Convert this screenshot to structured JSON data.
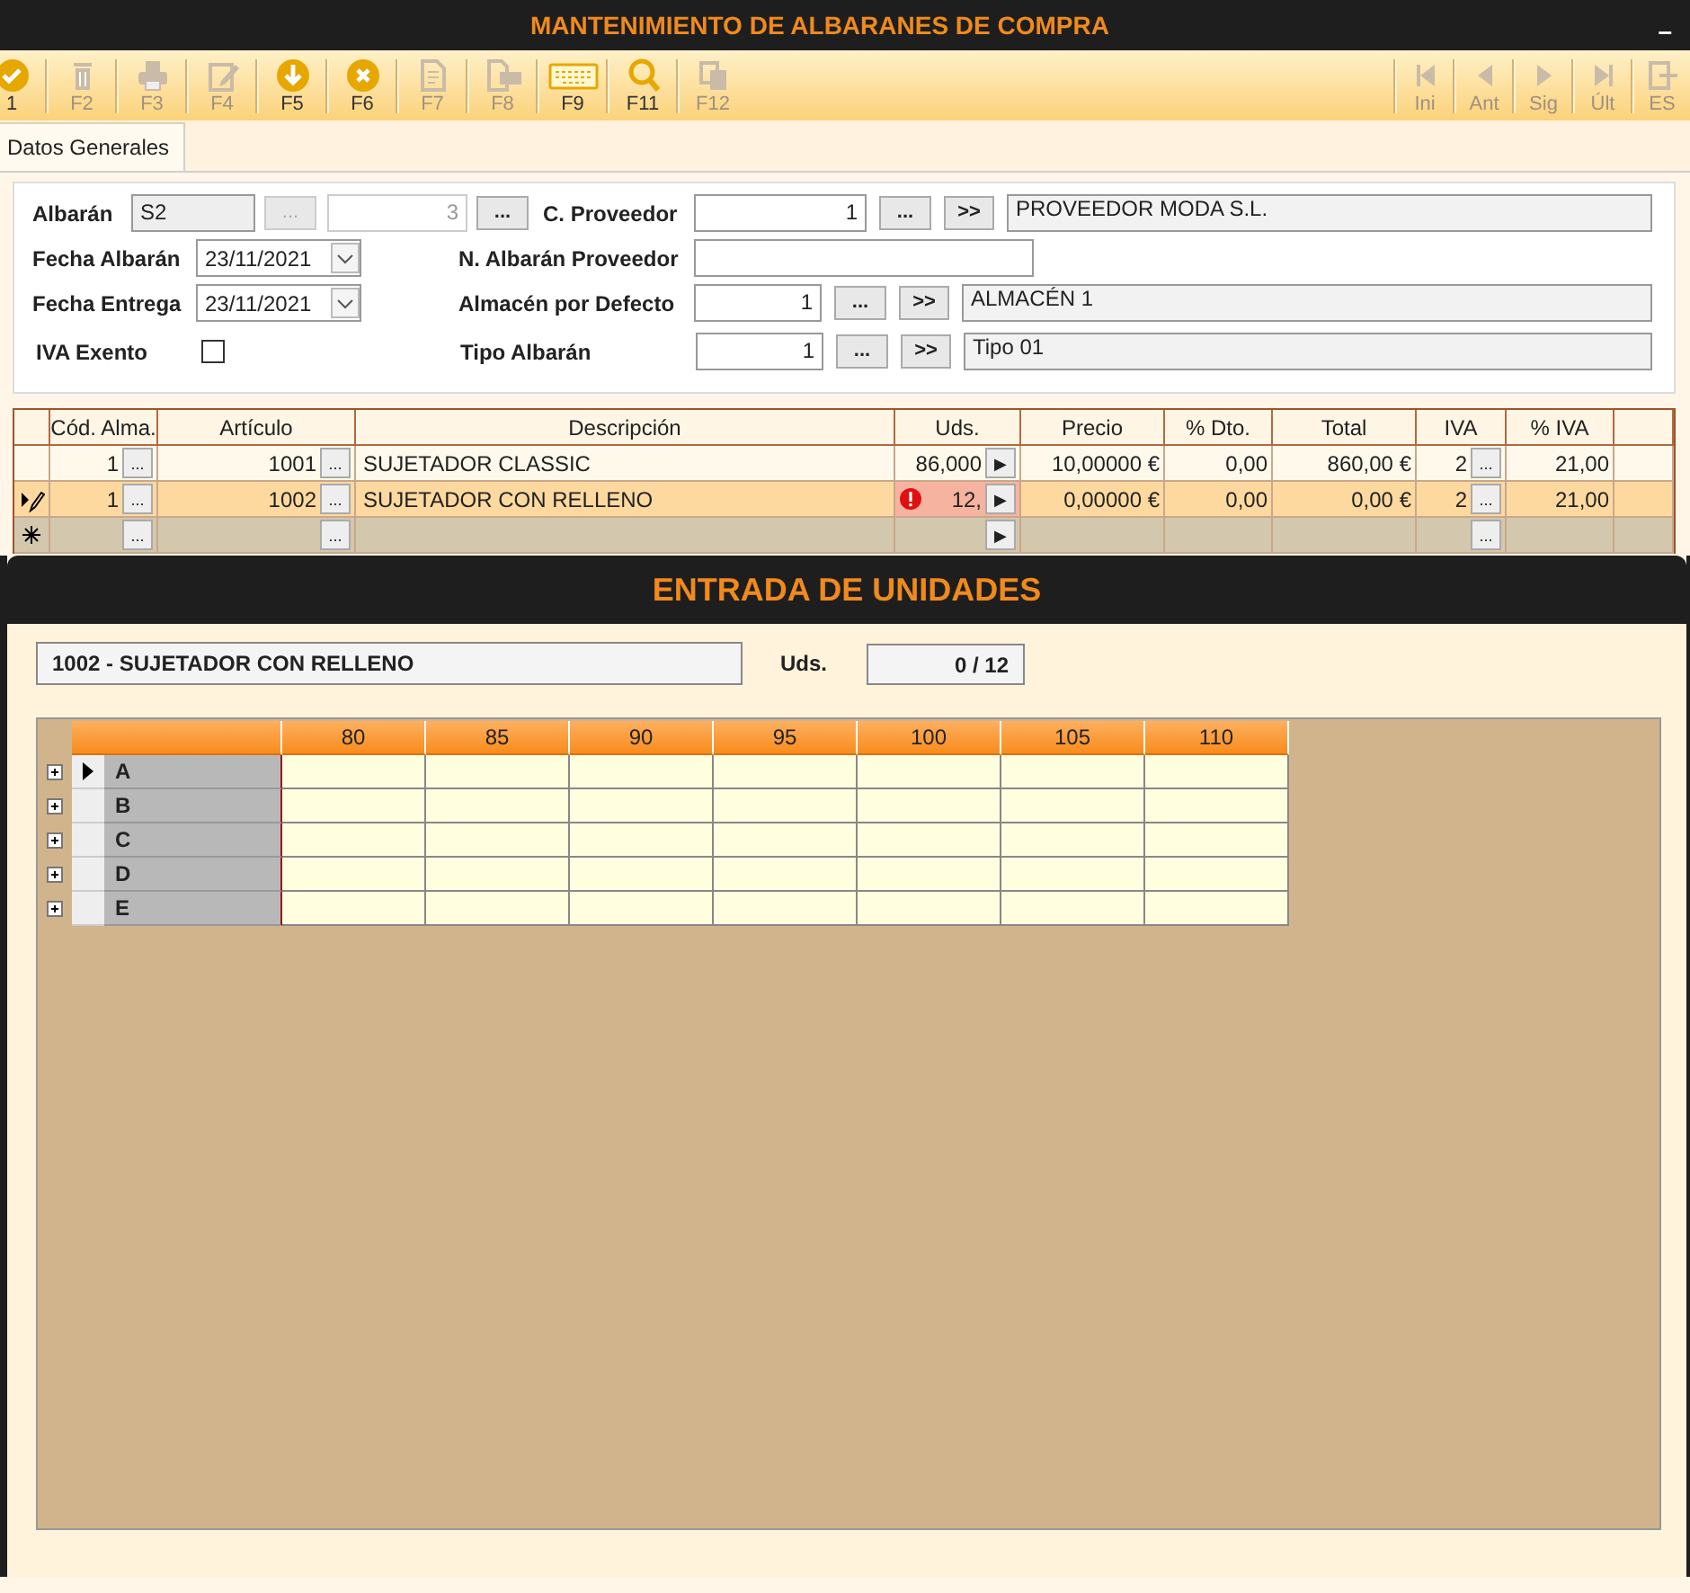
{
  "window": {
    "title": "MANTENIMIENTO DE ALBARANES DE COMPRA",
    "minimize": "–"
  },
  "toolbar": {
    "left": [
      {
        "label": "1",
        "kind": "confirm",
        "disabled": false
      },
      {
        "label": "F2",
        "kind": "delete",
        "disabled": true
      },
      {
        "label": "F3",
        "kind": "print",
        "disabled": true
      },
      {
        "label": "F4",
        "kind": "edit",
        "disabled": true
      },
      {
        "label": "F5",
        "kind": "save",
        "disabled": false
      },
      {
        "label": "F6",
        "kind": "cancel",
        "disabled": false
      },
      {
        "label": "F7",
        "kind": "document",
        "disabled": true
      },
      {
        "label": "F8",
        "kind": "numbered",
        "disabled": true
      },
      {
        "label": "F9",
        "kind": "keyboard",
        "disabled": false
      },
      {
        "label": "F11",
        "kind": "search",
        "disabled": false
      },
      {
        "label": "F12",
        "kind": "copy",
        "disabled": true
      }
    ],
    "right": [
      {
        "label": "Ini",
        "kind": "first",
        "disabled": true
      },
      {
        "label": "Ant",
        "kind": "prev",
        "disabled": true
      },
      {
        "label": "Sig",
        "kind": "next",
        "disabled": true
      },
      {
        "label": "Últ",
        "kind": "last",
        "disabled": true
      },
      {
        "label": "ES",
        "kind": "exit",
        "disabled": true
      }
    ]
  },
  "tabs": [
    {
      "label": "Datos Generales",
      "selected": true
    }
  ],
  "header": {
    "albaran": {
      "label": "Albarán",
      "series": "S2",
      "series_button": "...",
      "number": "3",
      "number_button": "..."
    },
    "dates": [
      {
        "label": "Fecha Albarán",
        "value": "23/11/2021"
      },
      {
        "label": "Fecha Entrega",
        "value": "23/11/2021"
      }
    ],
    "iva_exento": {
      "label": "IVA Exento",
      "checked": false
    },
    "lookups": [
      {
        "kind": "lookup",
        "label": "C. Proveedor",
        "code": "1",
        "browse": "...",
        "jump": ">>",
        "name": "PROVEEDOR MODA S.L."
      },
      {
        "kind": "text",
        "label": "N. Albarán Proveedor"
      },
      {
        "kind": "lookup",
        "label": "Almacén por Defecto",
        "code": "1",
        "browse": "...",
        "jump": ">>",
        "name": "ALMACÉN 1"
      },
      {
        "kind": "lookup",
        "label": "Tipo Albarán",
        "code": "1",
        "browse": "...",
        "jump": ">>",
        "name": "Tipo 01"
      }
    ]
  },
  "lines": {
    "columns": [
      "Cód. Alma.",
      "Artículo",
      "Descripción",
      "Uds.",
      "Precio",
      "% Dto.",
      "Total",
      "IVA",
      "% IVA"
    ],
    "rows": [
      {
        "kind": "data",
        "selected": false,
        "cells": [
          {
            "value": "1",
            "button": "..."
          },
          {
            "value": "1001",
            "button": "..."
          },
          {
            "value": "SUJETADOR CLASSIC"
          },
          {
            "value": "86,000",
            "button": "▶"
          },
          {
            "value": "10,00000 €"
          },
          {
            "value": "0,00"
          },
          {
            "value": "860,00 €"
          },
          {
            "value": "2",
            "button": "..."
          },
          {
            "value": "21,00"
          }
        ]
      },
      {
        "kind": "data",
        "selected": true,
        "cells": [
          {
            "value": "1",
            "button": "..."
          },
          {
            "value": "1002",
            "button": "..."
          },
          {
            "value": "SUJETADOR CON RELLENO"
          },
          {
            "value": "12,",
            "button": "▶",
            "error": true
          },
          {
            "value": "0,00000 €"
          },
          {
            "value": "0,00"
          },
          {
            "value": "0,00 €"
          },
          {
            "value": "2",
            "button": "..."
          },
          {
            "value": "21,00"
          }
        ]
      },
      {
        "kind": "new",
        "selected": false,
        "cells": [
          {
            "button": "..."
          },
          {
            "button": "..."
          },
          {},
          {
            "button": "▶"
          },
          {},
          {},
          {},
          {
            "button": "..."
          },
          {}
        ]
      }
    ]
  },
  "units_dialog": {
    "title": "ENTRADA DE UNIDADES",
    "article": "1002 - SUJETADOR CON RELLENO",
    "uds_label": "Uds.",
    "uds_value": "0 / 12",
    "sizes": [
      "80",
      "85",
      "90",
      "95",
      "100",
      "105",
      "110"
    ],
    "colors": [
      {
        "label": "A",
        "selected": true
      },
      {
        "label": "B",
        "selected": false
      },
      {
        "label": "C",
        "selected": false
      },
      {
        "label": "D",
        "selected": false
      },
      {
        "label": "E",
        "selected": false
      }
    ]
  }
}
